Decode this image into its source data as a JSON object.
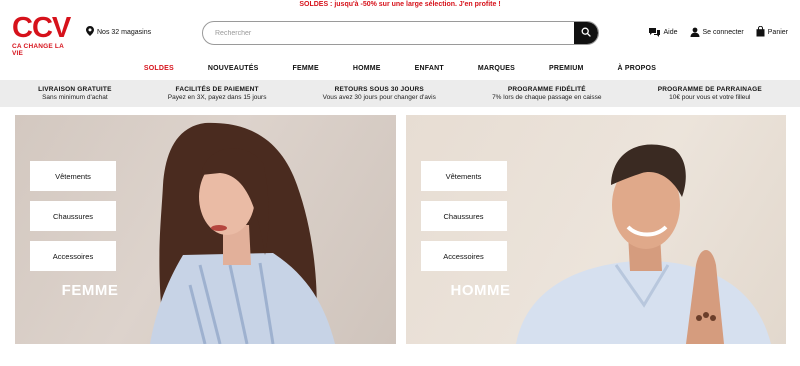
{
  "promo": "SOLDES : jusqu'à -50% sur une large sélection. J'en profite !",
  "logo": {
    "mark": "CCV",
    "tagline": "CA CHANGE LA VIE"
  },
  "stores": "Nos 32 magasins",
  "search": {
    "placeholder": "Rechercher"
  },
  "actions": {
    "help": "Aide",
    "login": "Se connecter",
    "cart": "Panier"
  },
  "nav": [
    "SOLDES",
    "NOUVEAUTÉS",
    "FEMME",
    "HOMME",
    "ENFANT",
    "MARQUES",
    "PREMIUM",
    "À PROPOS"
  ],
  "usps": [
    {
      "title": "LIVRAISON GRATUITE",
      "sub": "Sans minimum d'achat"
    },
    {
      "title": "FACILITÉS DE PAIEMENT",
      "sub": "Payez en 3X, payez dans 15 jours"
    },
    {
      "title": "RETOURS SOUS 30 JOURS",
      "sub": "Vous avez 30 jours pour changer d'avis"
    },
    {
      "title": "PROGRAMME FIDÉLITÉ",
      "sub": "7% lors de chaque passage en caisse"
    },
    {
      "title": "PROGRAMME DE PARRAINAGE",
      "sub": "10€ pour vous et votre filleul"
    }
  ],
  "hero": {
    "women": {
      "title": "FEMME",
      "links": [
        "Vêtements",
        "Chaussures",
        "Accessoires"
      ]
    },
    "men": {
      "title": "HOMME",
      "links": [
        "Vêtements",
        "Chaussures",
        "Accessoires"
      ]
    }
  },
  "colors": {
    "brand": "#d6121b",
    "usp_bg": "#ececec"
  }
}
